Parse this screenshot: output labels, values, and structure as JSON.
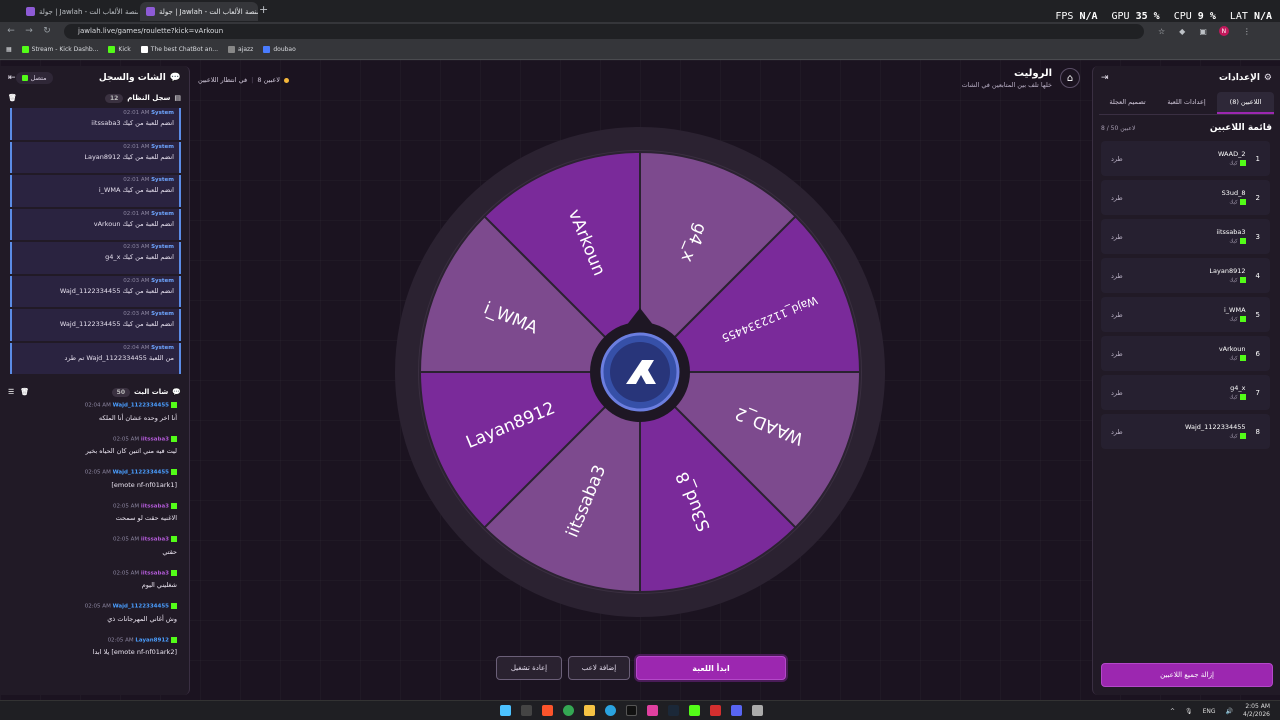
{
  "browser": {
    "tabs": [
      {
        "title": "جولة | Jawlah - منصة الألعاب الت"
      },
      {
        "title": "جولة | Jawlah - منصة الألعاب الت"
      }
    ],
    "new_tab": "+",
    "url": "jawlah.live/games/roulette?kick=vArkoun",
    "profile_letter": "N",
    "bookmarks": [
      "Stream - Kick Dashb...",
      "Kick",
      "The best ChatBot an...",
      "ajazz",
      "doubao"
    ]
  },
  "hud": {
    "fps_label": "FPS",
    "fps": "N/A",
    "gpu_label": "GPU",
    "gpu": "35 %",
    "cpu_label": "CPU",
    "cpu": "9 %",
    "lat_label": "LAT",
    "lat": "N/A"
  },
  "chat_panel": {
    "title": "الشات والسجل",
    "connected": "متصل",
    "system_log": {
      "title": "سجل النظام",
      "count": "12",
      "messages": [
        {
          "name": "System",
          "time": "02:01 AM",
          "text": "iitssaba3 انضم للعبة من كيك"
        },
        {
          "name": "System",
          "time": "02:01 AM",
          "text": "Layan8912 انضم للعبة من كيك"
        },
        {
          "name": "System",
          "time": "02:01 AM",
          "text": "i_WMA انضم للعبة من كيك"
        },
        {
          "name": "System",
          "time": "02:01 AM",
          "text": "vArkoun انضم للعبة من كيك"
        },
        {
          "name": "System",
          "time": "02:03 AM",
          "text": "g4_x انضم للعبة من كيك"
        },
        {
          "name": "System",
          "time": "02:03 AM",
          "text": "Wajd_1122334455 انضم للعبة من كيك"
        },
        {
          "name": "System",
          "time": "02:03 AM",
          "text": "Wajd_1122334455 انضم للعبة من كيك"
        },
        {
          "name": "System",
          "time": "02:04 AM",
          "text": "تم طرد Wajd_1122334455 من اللعبة"
        }
      ]
    },
    "live_chat": {
      "title": "شات البث",
      "count": "50",
      "messages": [
        {
          "name": "Wajd_1122334455",
          "time": "02:04 AM",
          "text": "أنا اخر وحده عشان أنا الملكه",
          "color": "#4a9eff"
        },
        {
          "name": "iitssaba3",
          "time": "02:05 AM",
          "text": "ليت فيه مني اثنين كان الحياه بخير",
          "color": "#b15ad6"
        },
        {
          "name": "Wajd_1122334455",
          "time": "02:05 AM",
          "text": "[emote nf-nf01ark1]",
          "color": "#4a9eff"
        },
        {
          "name": "iitssaba3",
          "time": "02:05 AM",
          "text": "الاغنيه حقت لو سمحت",
          "color": "#b15ad6"
        },
        {
          "name": "iitssaba3",
          "time": "02:05 AM",
          "text": "حقتي",
          "color": "#b15ad6"
        },
        {
          "name": "iitssaba3",
          "time": "02:05 AM",
          "text": "شغليني اليوم",
          "color": "#b15ad6"
        },
        {
          "name": "Wajd_1122334455",
          "time": "02:05 AM",
          "text": "وش أغاني المهرجانات ذي",
          "color": "#4a9eff"
        },
        {
          "name": "Layan8912",
          "time": "02:05 AM",
          "text": "يلا ابدا [emote nf-nf01ark2]",
          "color": "#4a9eff"
        }
      ]
    }
  },
  "game": {
    "title": "الروليت",
    "subtitle": "خلها تلف بين المتابعين في الشات",
    "status_waiting": "في انتظار اللاعبين",
    "status_players": "8 لاعبين",
    "wheel_segments": [
      "vArkoun",
      "g4_x",
      "Wajd_1122334455",
      "WAAD_2",
      "S3ud_8",
      "iitssaba3",
      "Layan8912",
      "i_WMA"
    ],
    "start_button": "ابدأ اللعبة",
    "add_player_button": "إضافة لاعب",
    "restart_button": "إعادة تشغيل"
  },
  "settings_panel": {
    "title": "الإعدادات",
    "tabs": [
      "اللاعبين (8)",
      "إعدادات اللعبة",
      "تصميم العجلة"
    ],
    "list_title": "قائمة اللاعبين",
    "list_count": "8 / 50 لاعبين",
    "kick_label": "طرد",
    "platform_label": "كيك",
    "players": [
      "WAAD_2",
      "S3ud_8",
      "iitssaba3",
      "Layan8912",
      "i_WMA",
      "vArkoun",
      "g4_x",
      "Wajd_1122334455"
    ],
    "remove_all": "إزالة جميع اللاعبين"
  },
  "taskbar": {
    "lang": "ENG",
    "time": "2:05 AM",
    "date": "4/2/2026"
  }
}
